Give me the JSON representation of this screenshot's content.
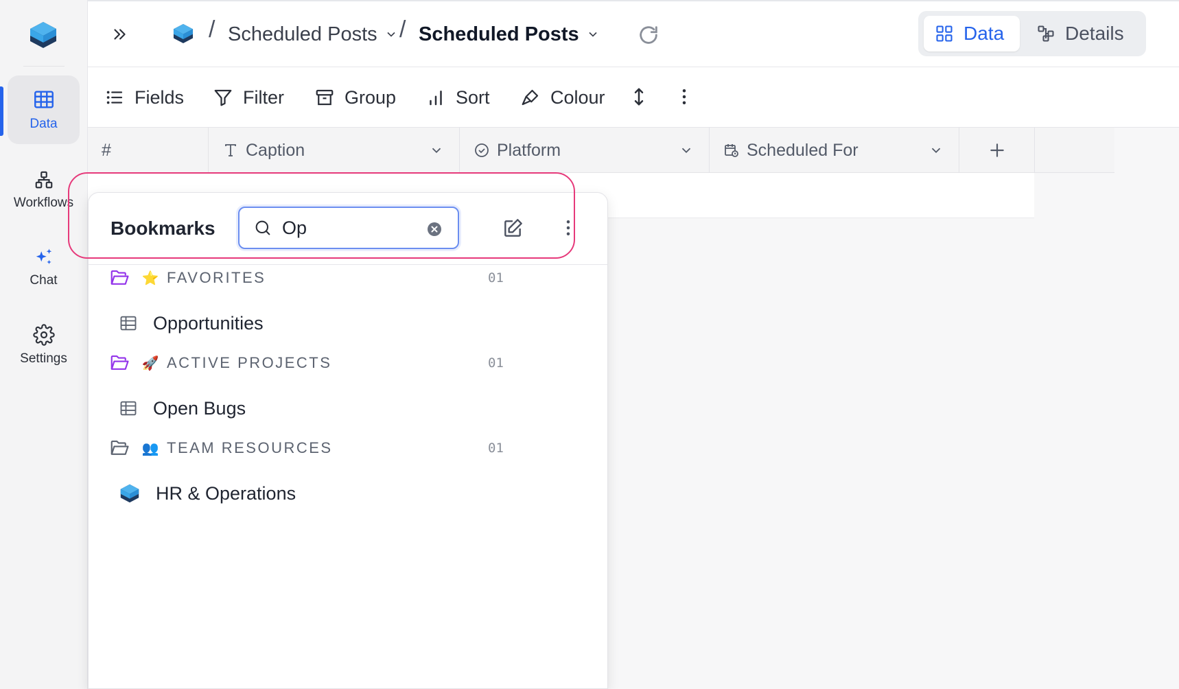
{
  "rail": {
    "items": [
      {
        "label": "Data",
        "active": true
      },
      {
        "label": "Workflows",
        "active": false
      },
      {
        "label": "Chat",
        "active": false
      },
      {
        "label": "Settings",
        "active": false
      }
    ]
  },
  "header": {
    "breadcrumbs": [
      "Scheduled Posts",
      "Scheduled Posts"
    ],
    "view_tabs": [
      {
        "label": "Data",
        "active": true
      },
      {
        "label": "Details",
        "active": false
      }
    ]
  },
  "toolbar": {
    "fields": "Fields",
    "filter": "Filter",
    "group": "Group",
    "sort": "Sort",
    "colour": "Colour"
  },
  "grid": {
    "columns": [
      {
        "label": "#",
        "icon": "hash"
      },
      {
        "label": "Caption",
        "icon": "text-type-icon"
      },
      {
        "label": "Platform",
        "icon": "circle-check-icon"
      },
      {
        "label": "Scheduled For",
        "icon": "calendar-clock-icon"
      }
    ]
  },
  "bookmarks": {
    "title": "Bookmarks",
    "search_value": "Op",
    "folders": [
      {
        "emoji": "⭐",
        "name": "FAVORITES",
        "count": "01",
        "item": {
          "label": "Opportunities",
          "icon": "table-icon"
        }
      },
      {
        "emoji": "🚀",
        "name": "ACTIVE PROJECTS",
        "count": "01",
        "item": {
          "label": "Open Bugs",
          "icon": "table-icon"
        }
      },
      {
        "emoji": "👥",
        "name": "TEAM RESOURCES",
        "count": "01",
        "item": {
          "label": "HR & Operations",
          "icon": "base-logo-icon"
        }
      }
    ]
  },
  "colors": {
    "accent": "#2563eb",
    "folder_purple": "#9333ea",
    "highlight": "#e6397a",
    "logo_top": "#3aa6e8",
    "logo_side": "#1e3a5f"
  }
}
